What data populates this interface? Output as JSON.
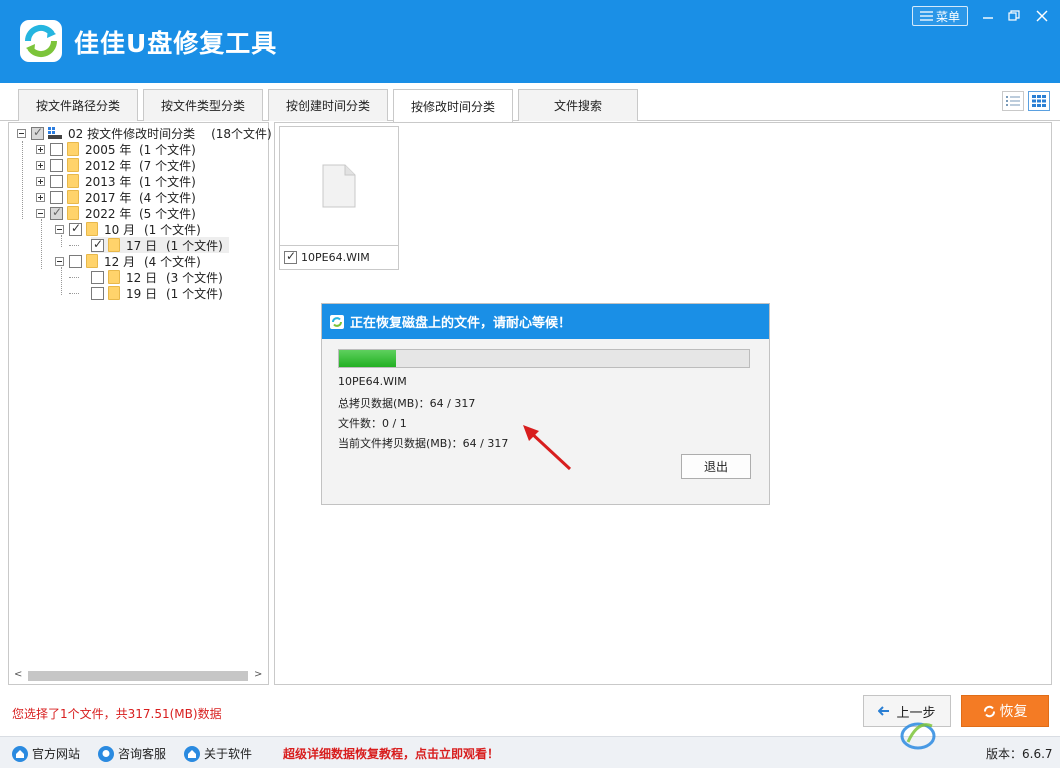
{
  "app": {
    "title": "佳佳U盘修复工具",
    "menu_label": "菜单"
  },
  "tabs": [
    {
      "label": "按文件路径分类",
      "active": false
    },
    {
      "label": "按文件类型分类",
      "active": false
    },
    {
      "label": "按创建时间分类",
      "active": false
    },
    {
      "label": "按修改时间分类",
      "active": true
    },
    {
      "label": "文件搜索",
      "active": false
    }
  ],
  "tree": {
    "root": {
      "label": "02 按文件修改时间分类",
      "count": "(18个文件)"
    },
    "items": [
      {
        "label": "2005 年",
        "count": "(1 个文件)"
      },
      {
        "label": "2012 年",
        "count": "(7 个文件)"
      },
      {
        "label": "2013 年",
        "count": "(1 个文件)"
      },
      {
        "label": "2017 年",
        "count": "(4 个文件)"
      },
      {
        "label": "2022 年",
        "count": "(5 个文件)"
      },
      {
        "label": "10 月",
        "count": "(1 个文件)"
      },
      {
        "label": "17 日",
        "count": "(1 个文件)"
      },
      {
        "label": "12 月",
        "count": "(4 个文件)"
      },
      {
        "label": "12 日",
        "count": "(3 个文件)"
      },
      {
        "label": "19 日",
        "count": "(1 个文件)"
      }
    ]
  },
  "file_card": {
    "name": "10PE64.WIM"
  },
  "dialog": {
    "title": "正在恢复磁盘上的文件，请耐心等候！",
    "progress": 0.14,
    "current_file": "10PE64.WIM",
    "total_label": "总拷贝数据(MB)：",
    "total_value": "64 / 317",
    "files_label": "文件数：",
    "files_value": "0 / 1",
    "current_label": "当前文件拷贝数据(MB)：",
    "current_value": "64 / 317",
    "exit_label": "退出"
  },
  "bottom": {
    "status": "您选择了1个文件，共317.51(MB)数据",
    "prev_label": "上一步",
    "recover_label": "恢复"
  },
  "footer": {
    "links": [
      "官方网站",
      "咨询客服",
      "关于软件"
    ],
    "promo": "超级详细数据恢复教程，点击立即观看！",
    "version": "版本：6.6.7"
  },
  "colors": {
    "brand": "#1a8fe6",
    "accent": "#f47b24",
    "alert": "#d81e1e",
    "progress": "#22b022"
  }
}
